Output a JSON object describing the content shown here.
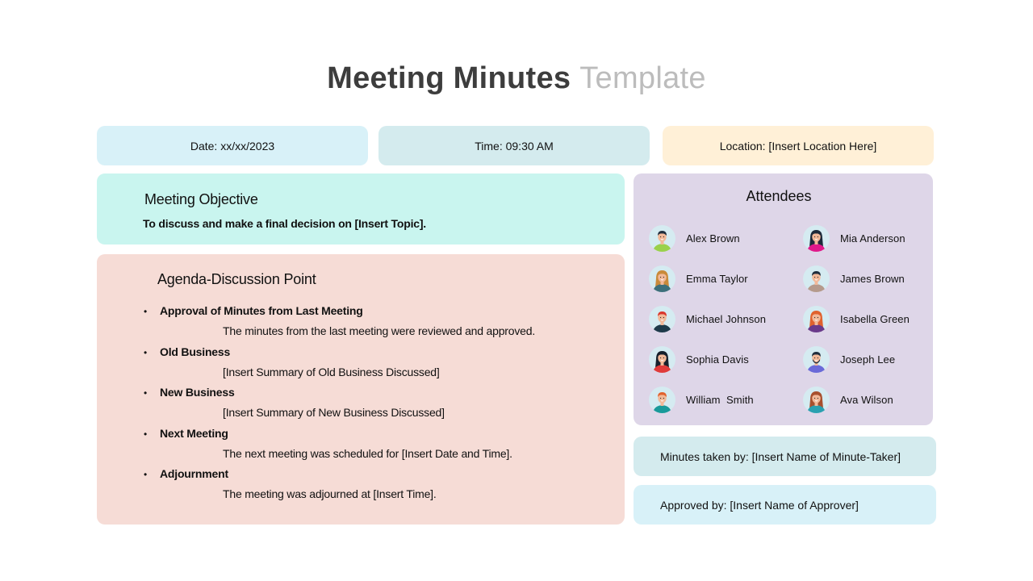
{
  "title": {
    "main": "Meeting Minutes",
    "accent": "Template"
  },
  "meta": {
    "date": "Date: xx/xx/2023",
    "time": "Time: 09:30 AM",
    "location": "Location: [Insert Location Here]"
  },
  "objective": {
    "heading": "Meeting Objective",
    "text": "To discuss and make a final decision on [Insert Topic]."
  },
  "agenda": {
    "heading": "Agenda-Discussion Point",
    "bullet": "•",
    "items": [
      {
        "title": "Approval of Minutes from Last Meeting",
        "desc": "The minutes from the last meeting were reviewed and approved."
      },
      {
        "title": "Old Business",
        "desc": "[Insert Summary of Old Business Discussed]"
      },
      {
        "title": "New Business",
        "desc": "[Insert Summary of New Business Discussed]"
      },
      {
        "title": "Next Meeting",
        "desc": "The next meeting was scheduled for [Insert Date and Time]."
      },
      {
        "title": "Adjournment",
        "desc": "The meeting was adjourned at [Insert Time]."
      }
    ]
  },
  "attendees": {
    "heading": "Attendees",
    "people": [
      {
        "name": "Alex Brown",
        "avatar": {
          "hair": "#1f2d3d",
          "skin": "#f2b999",
          "shirt": "#9ad14b",
          "long": false,
          "beard": false
        }
      },
      {
        "name": "Mia Anderson",
        "avatar": {
          "hair": "#1d2a3a",
          "skin": "#f2b999",
          "shirt": "#e0198a",
          "long": true,
          "beard": false
        }
      },
      {
        "name": "Emma Taylor",
        "avatar": {
          "hair": "#c98a3a",
          "skin": "#f2b999",
          "shirt": "#3d6f7a",
          "long": true,
          "beard": false
        }
      },
      {
        "name": "James Brown",
        "avatar": {
          "hair": "#1f2d3d",
          "skin": "#f2b999",
          "shirt": "#b59a8c",
          "long": false,
          "beard": false
        }
      },
      {
        "name": "Michael Johnson",
        "avatar": {
          "hair": "#d9362b",
          "skin": "#f2b999",
          "shirt": "#1e3a4a",
          "long": false,
          "beard": false
        }
      },
      {
        "name": "Isabella Green",
        "avatar": {
          "hair": "#e0622e",
          "skin": "#f2b999",
          "shirt": "#6a3a8a",
          "long": true,
          "beard": false
        }
      },
      {
        "name": "Sophia Davis",
        "avatar": {
          "hair": "#16202c",
          "skin": "#f2b999",
          "shirt": "#e03a3a",
          "long": true,
          "beard": false
        }
      },
      {
        "name": "Joseph Lee",
        "avatar": {
          "hair": "#1f2d3d",
          "skin": "#f2b999",
          "shirt": "#6a6ad8",
          "long": false,
          "beard": true
        }
      },
      {
        "name": "William  Smith",
        "avatar": {
          "hair": "#e0622e",
          "skin": "#f2b999",
          "shirt": "#1a9a9a",
          "long": false,
          "beard": false
        }
      },
      {
        "name": "Ava Wilson",
        "avatar": {
          "hair": "#a8502e",
          "skin": "#f2b999",
          "shirt": "#2aa0b0",
          "long": true,
          "beard": false
        }
      }
    ]
  },
  "minutes_taken_by": "Minutes taken by: [Insert Name of Minute-Taker]",
  "approved_by": "Approved by: [Insert Name of Approver]"
}
